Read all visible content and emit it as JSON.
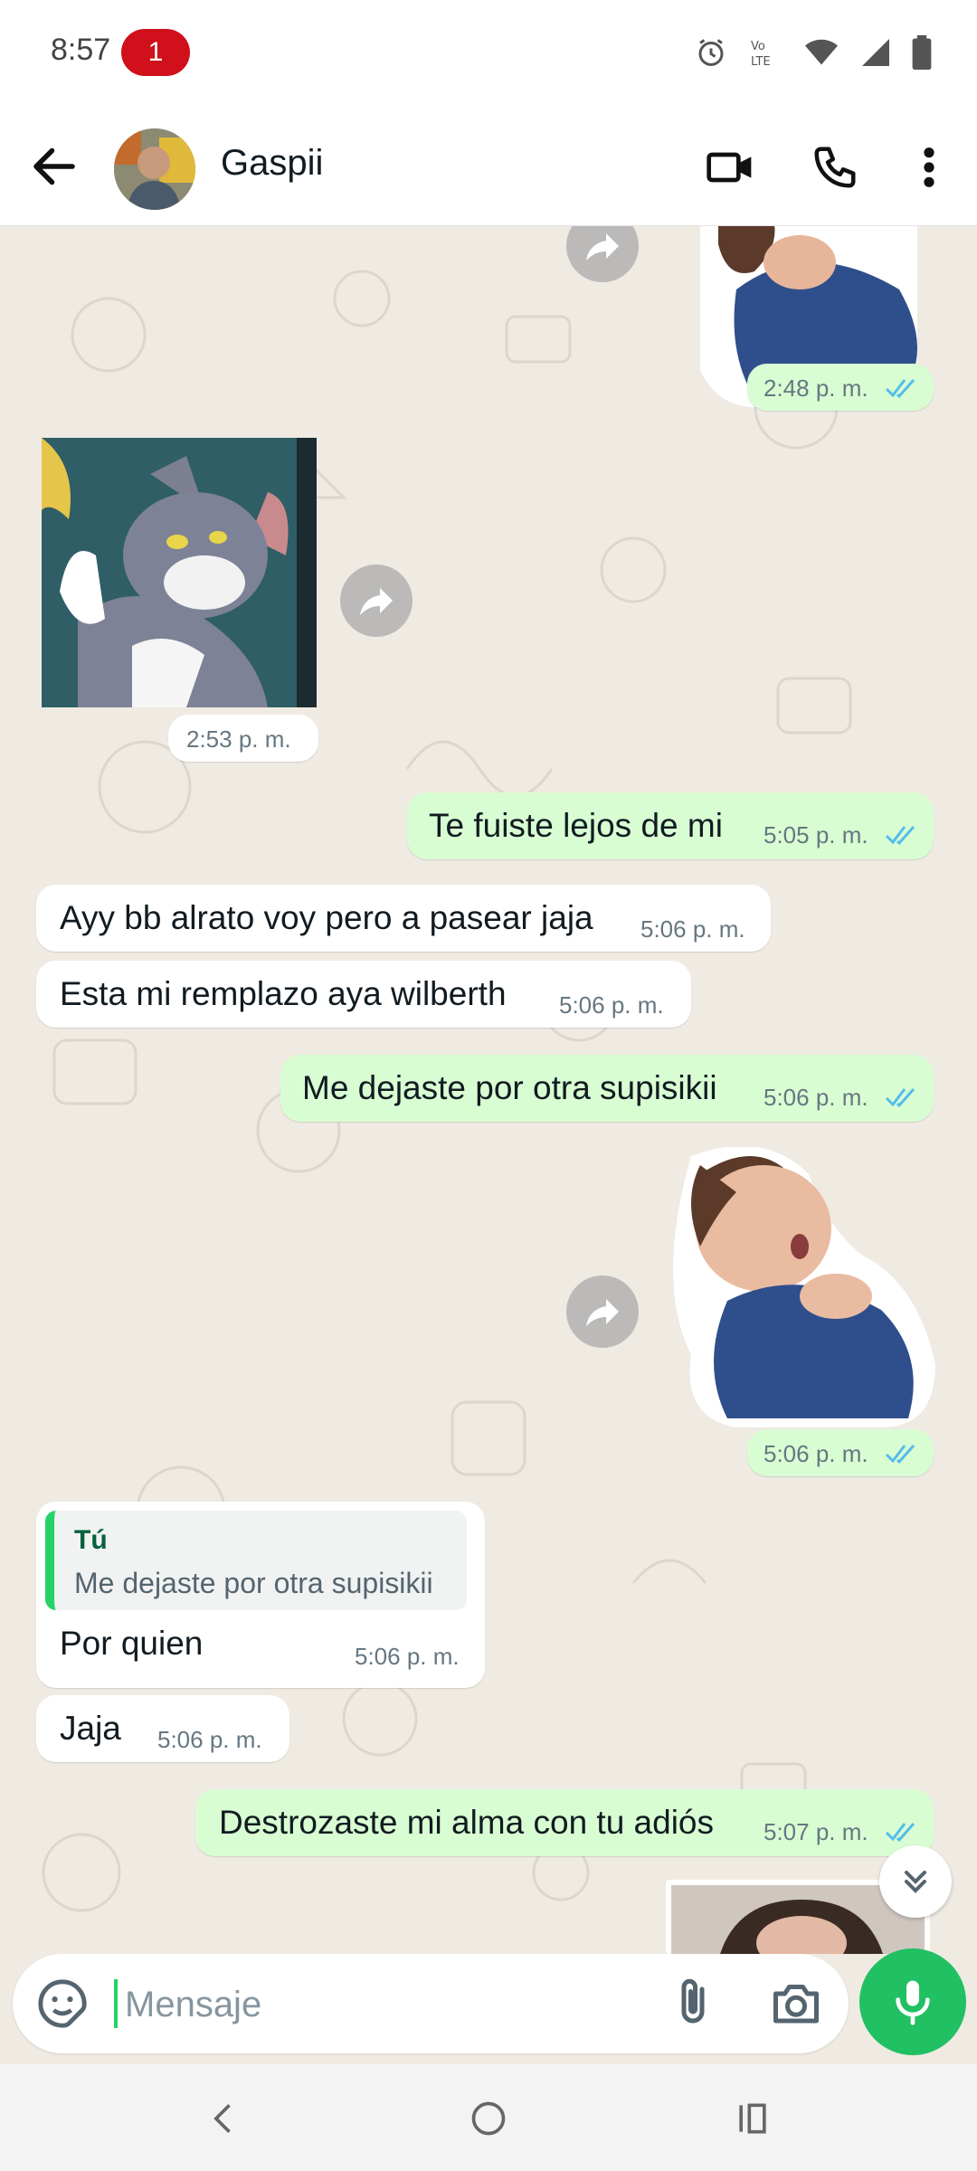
{
  "status_bar": {
    "time": "8:57",
    "notification_count": "1",
    "icons": [
      "alarm-icon",
      "volte-icon",
      "wifi-icon",
      "signal-icon",
      "battery-icon"
    ]
  },
  "header": {
    "contact_name": "Gaspii",
    "actions": [
      "video-call-icon",
      "voice-call-icon",
      "more-options-icon"
    ]
  },
  "messages": [
    {
      "direction": "out",
      "type": "sticker",
      "time": "2:48 p. m.",
      "status": "read"
    },
    {
      "direction": "in",
      "type": "sticker",
      "time": "2:53 p. m."
    },
    {
      "direction": "out",
      "type": "text",
      "text": "Te fuiste lejos de mi",
      "time": "5:05 p. m.",
      "status": "read"
    },
    {
      "direction": "in",
      "type": "text",
      "text": "Ayy bb alrato voy pero a pasear jaja",
      "time": "5:06 p. m."
    },
    {
      "direction": "in",
      "type": "text",
      "text": "Esta mi remplazo aya wilberth",
      "time": "5:06 p. m."
    },
    {
      "direction": "out",
      "type": "text",
      "text": "Me dejaste por otra supisikii",
      "time": "5:06 p. m.",
      "status": "read"
    },
    {
      "direction": "out",
      "type": "sticker",
      "time": "5:06 p. m.",
      "status": "read"
    },
    {
      "direction": "in",
      "type": "reply",
      "quote_author": "Tú",
      "quote_text": "Me dejaste por otra supisikii",
      "text": "Por quien",
      "time": "5:06 p. m."
    },
    {
      "direction": "in",
      "type": "text",
      "text": "Jaja",
      "time": "5:06 p. m."
    },
    {
      "direction": "out",
      "type": "text",
      "text": "Destrozaste mi alma con tu adiós",
      "time": "5:07 p. m.",
      "status": "read"
    },
    {
      "direction": "out",
      "type": "sticker",
      "partial": true
    }
  ],
  "composer": {
    "placeholder": "Mensaje",
    "value": ""
  },
  "navigation": [
    "back-nav-icon",
    "home-nav-icon",
    "recents-nav-icon"
  ],
  "colors": {
    "chat_background": "#efeae2",
    "outgoing_bubble": "#d9fdd3",
    "incoming_bubble": "#ffffff",
    "read_ticks": "#53bdeb",
    "accent_green": "#21c063",
    "badge_red": "#d0101a"
  }
}
